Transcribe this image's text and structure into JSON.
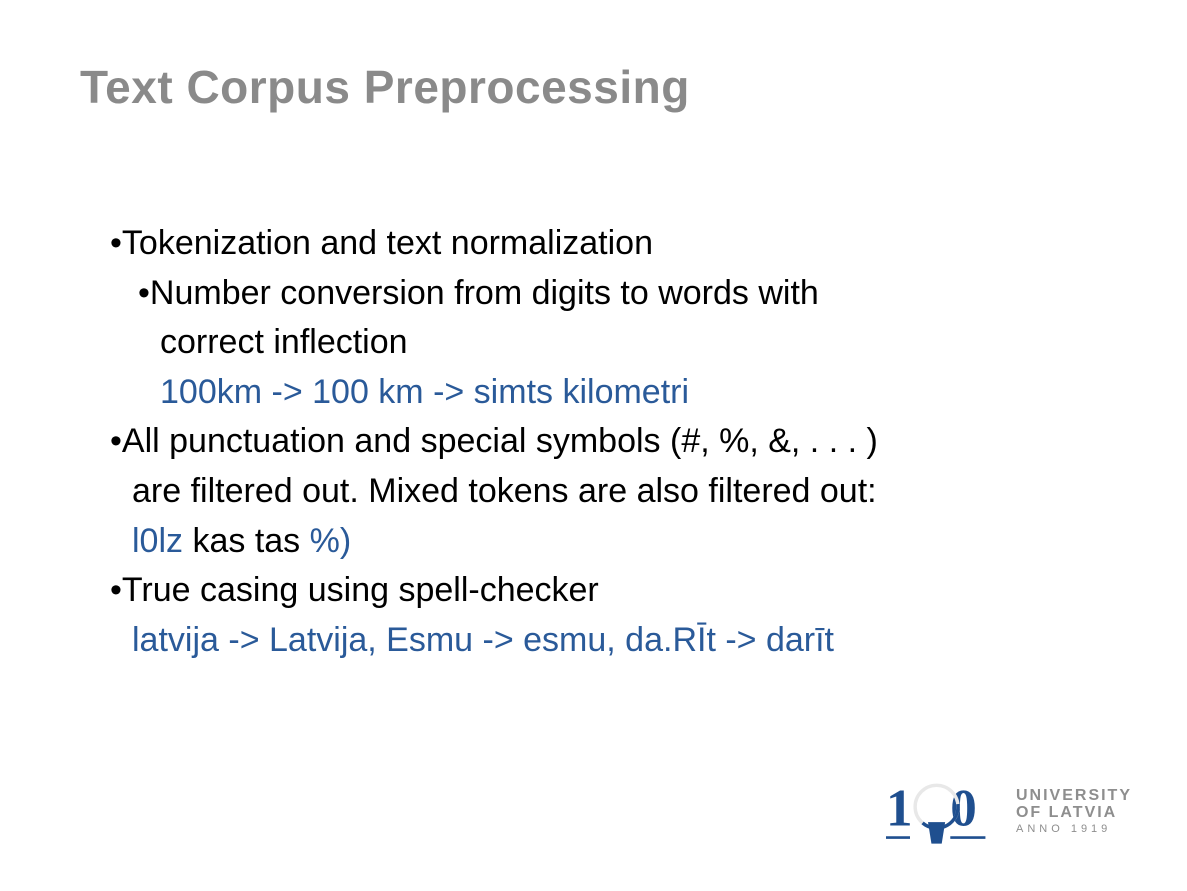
{
  "title": "Text Corpus Preprocessing",
  "bullets": {
    "b1": "Tokenization and text normalization",
    "b1a": "Number conversion from digits to words with",
    "b1a_cont": "correct inflection",
    "b1a_ex": "100km -> 100 km -> simts kilometri",
    "b2": "All punctuation and special symbols (#, %, &, . . . )",
    "b2_cont": "are filtered out. Mixed tokens are also filtered out:",
    "b2_ex_pre": "l0lz ",
    "b2_ex_mid": "kas tas ",
    "b2_ex_post": "%)",
    "b3": "True casing using spell-checker",
    "b3_ex": "latvija -> Latvija, Esmu -> esmu, da.RĪt -> darīt"
  },
  "logo": {
    "line1": "UNIVERSITY",
    "line2": "OF LATVIA",
    "year": "ANNO 1919"
  },
  "colors": {
    "title_gray": "#8a8a8a",
    "example_blue": "#2a5a99",
    "logo_blue": "#1f4f8f"
  }
}
